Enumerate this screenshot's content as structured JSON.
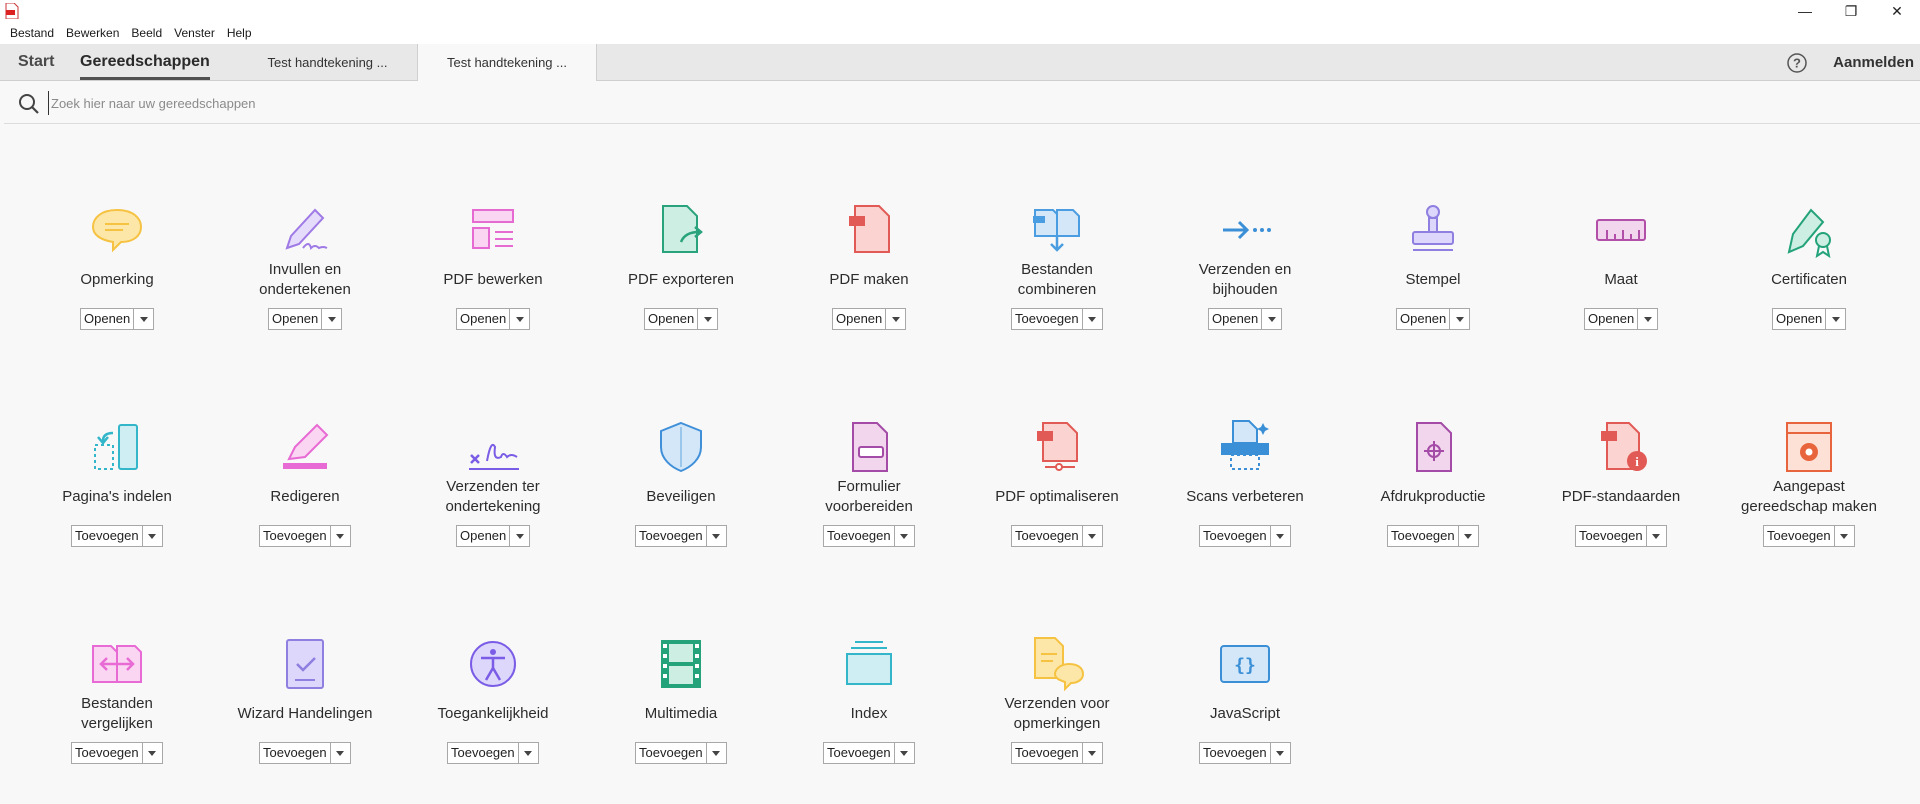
{
  "window": {
    "minimize": "—",
    "restore": "❐",
    "close": "✕"
  },
  "menu": [
    "Bestand",
    "Bewerken",
    "Beeld",
    "Venster",
    "Help"
  ],
  "tabs": {
    "start": "Start",
    "tools": "Gereedschappen",
    "doc1": "Test handtekening ...",
    "doc2": "Test handtekening ..."
  },
  "header": {
    "signin": "Aanmelden"
  },
  "search": {
    "placeholder": "Zoek hier naar uw gereedschappen"
  },
  "tools": [
    {
      "label": "Opmerking",
      "button": "Openen",
      "icon": "comment-icon",
      "color": "#f5c242"
    },
    {
      "label": "Invullen en ondertekenen",
      "button": "Openen",
      "icon": "fill-sign-icon",
      "color": "#9f7ae6"
    },
    {
      "label": "PDF bewerken",
      "button": "Openen",
      "icon": "edit-pdf-icon",
      "color": "#e56bd2"
    },
    {
      "label": "PDF exporteren",
      "button": "Openen",
      "icon": "export-pdf-icon",
      "color": "#29a37c"
    },
    {
      "label": "PDF maken",
      "button": "Openen",
      "icon": "create-pdf-icon",
      "color": "#e15a55"
    },
    {
      "label": "Bestanden combineren",
      "button": "Toevoegen",
      "icon": "combine-files-icon",
      "color": "#4a9de0"
    },
    {
      "label": "Verzenden en bijhouden",
      "button": "Openen",
      "icon": "send-track-icon",
      "color": "#3b8fd6"
    },
    {
      "label": "Stempel",
      "button": "Openen",
      "icon": "stamp-icon",
      "color": "#8e7fe0"
    },
    {
      "label": "Maat",
      "button": "Openen",
      "icon": "measure-icon",
      "color": "#b24fa8"
    },
    {
      "label": "Certificaten",
      "button": "Openen",
      "icon": "certificate-icon",
      "color": "#24a37a"
    },
    {
      "label": "Pagina's indelen",
      "button": "Toevoegen",
      "icon": "organize-pages-icon",
      "color": "#33b6c9"
    },
    {
      "label": "Redigeren",
      "button": "Toevoegen",
      "icon": "redact-icon",
      "color": "#e86ad4"
    },
    {
      "label": "Verzenden ter ondertekening",
      "button": "Openen",
      "icon": "send-sign-icon",
      "color": "#7a5ce6"
    },
    {
      "label": "Beveiligen",
      "button": "Toevoegen",
      "icon": "protect-shield-icon",
      "color": "#3f8fd9"
    },
    {
      "label": "Formulier voorbereiden",
      "button": "Toevoegen",
      "icon": "prepare-form-icon",
      "color": "#a34ba6"
    },
    {
      "label": "PDF optimaliseren",
      "button": "Toevoegen",
      "icon": "optimize-pdf-icon",
      "color": "#e15a55"
    },
    {
      "label": "Scans verbeteren",
      "button": "Toevoegen",
      "icon": "enhance-scans-icon",
      "color": "#3b8fd6"
    },
    {
      "label": "Afdrukproductie",
      "button": "Toevoegen",
      "icon": "print-production-icon",
      "color": "#a34ba6"
    },
    {
      "label": "PDF-standaarden",
      "button": "Toevoegen",
      "icon": "pdf-standards-icon",
      "color": "#e15a55"
    },
    {
      "label": "Aangepast gereedschap maken",
      "button": "Toevoegen",
      "icon": "custom-tool-icon",
      "color": "#e8643c"
    },
    {
      "label": "Bestanden vergelijken",
      "button": "Toevoegen",
      "icon": "compare-files-icon",
      "color": "#e86ad4"
    },
    {
      "label": "Wizard Handelingen",
      "button": "Toevoegen",
      "icon": "action-wizard-icon",
      "color": "#8e7fe0"
    },
    {
      "label": "Toegankelijkheid",
      "button": "Toevoegen",
      "icon": "accessibility-icon",
      "color": "#7a5ce6"
    },
    {
      "label": "Multimedia",
      "button": "Toevoegen",
      "icon": "multimedia-icon",
      "color": "#24a37a"
    },
    {
      "label": "Index",
      "button": "Toevoegen",
      "icon": "index-icon",
      "color": "#33b6c9"
    },
    {
      "label": "Verzenden voor opmerkingen",
      "button": "Toevoegen",
      "icon": "send-comments-icon",
      "color": "#f5c242"
    },
    {
      "label": "JavaScript",
      "button": "Toevoegen",
      "icon": "javascript-icon",
      "color": "#3b8fd6"
    }
  ]
}
